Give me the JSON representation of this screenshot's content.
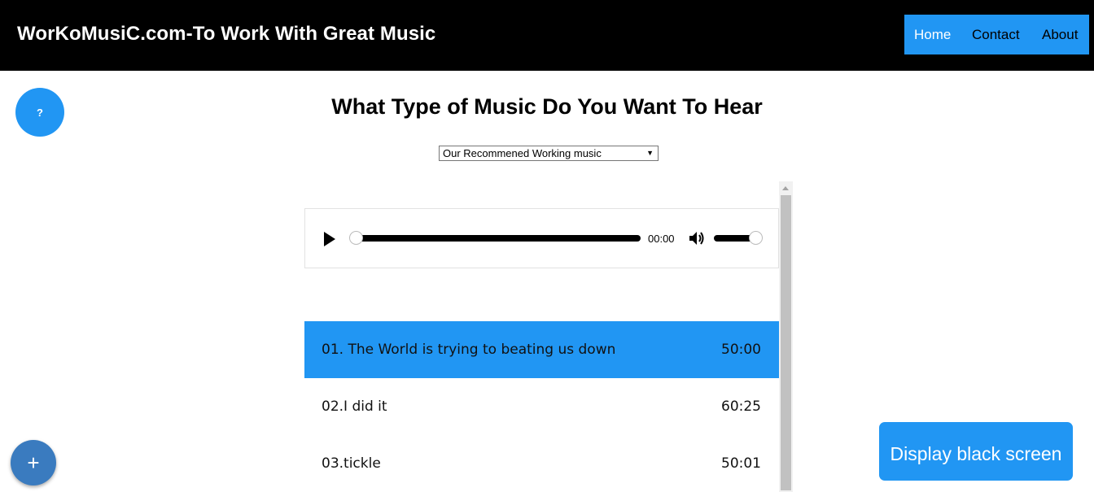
{
  "header": {
    "site_title": "WorKoMusiC.com-To Work With Great Music",
    "nav": {
      "home": "Home",
      "contact": "Contact",
      "about": "About"
    }
  },
  "help_button": {
    "label": "?"
  },
  "main": {
    "heading": "What Type of Music Do You Want To Hear",
    "genre_select": {
      "selected": "Our Recommened Working music"
    }
  },
  "player": {
    "current_time": "00:00",
    "progress": 0,
    "volume": 1,
    "icons": {
      "play": "play-icon",
      "volume": "volume-icon"
    }
  },
  "playlist": [
    {
      "title": "01.  The World is trying to beating us down",
      "duration": "50:00",
      "active": true
    },
    {
      "title": "02.I did it",
      "duration": "60:25",
      "active": false
    },
    {
      "title": "03.tickle",
      "duration": "50:01",
      "active": false
    }
  ],
  "add_button": {
    "label": "+"
  },
  "black_screen_button": {
    "label": "Display black screen"
  },
  "colors": {
    "accent": "#2196f3",
    "header_bg": "#000000",
    "fab": "#3a7bbf"
  }
}
